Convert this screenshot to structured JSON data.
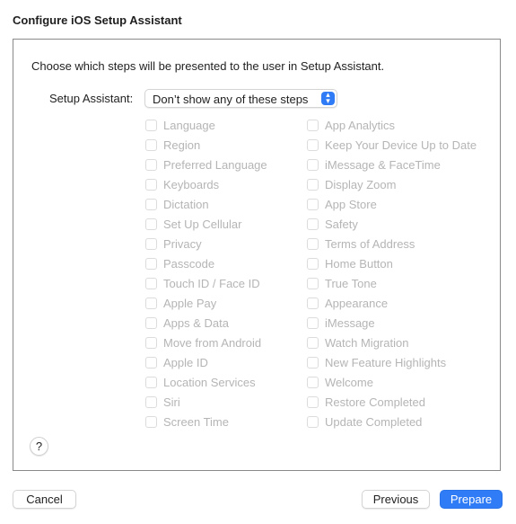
{
  "window": {
    "title": "Configure iOS Setup Assistant"
  },
  "panel": {
    "intro": "Choose which steps will be presented to the user in Setup Assistant.",
    "setup_assistant": {
      "label": "Setup Assistant:",
      "selected": "Don’t show any of these steps",
      "icon": "up-down-chevron-icon"
    },
    "steps_left": [
      {
        "label": "Language",
        "checked": false,
        "enabled": false
      },
      {
        "label": "Region",
        "checked": false,
        "enabled": false
      },
      {
        "label": "Preferred Language",
        "checked": false,
        "enabled": false
      },
      {
        "label": "Keyboards",
        "checked": false,
        "enabled": false
      },
      {
        "label": "Dictation",
        "checked": false,
        "enabled": false
      },
      {
        "label": "Set Up Cellular",
        "checked": false,
        "enabled": false
      },
      {
        "label": "Privacy",
        "checked": false,
        "enabled": false
      },
      {
        "label": "Passcode",
        "checked": false,
        "enabled": false
      },
      {
        "label": "Touch ID / Face ID",
        "checked": false,
        "enabled": false
      },
      {
        "label": "Apple Pay",
        "checked": false,
        "enabled": false
      },
      {
        "label": "Apps & Data",
        "checked": false,
        "enabled": false
      },
      {
        "label": "Move from Android",
        "checked": false,
        "enabled": false
      },
      {
        "label": "Apple ID",
        "checked": false,
        "enabled": false
      },
      {
        "label": "Location Services",
        "checked": false,
        "enabled": false
      },
      {
        "label": "Siri",
        "checked": false,
        "enabled": false
      },
      {
        "label": "Screen Time",
        "checked": false,
        "enabled": false
      }
    ],
    "steps_right": [
      {
        "label": "App Analytics",
        "checked": false,
        "enabled": false
      },
      {
        "label": "Keep Your Device Up to Date",
        "checked": false,
        "enabled": false
      },
      {
        "label": "iMessage & FaceTime",
        "checked": false,
        "enabled": false
      },
      {
        "label": "Display Zoom",
        "checked": false,
        "enabled": false
      },
      {
        "label": "App Store",
        "checked": false,
        "enabled": false
      },
      {
        "label": "Safety",
        "checked": false,
        "enabled": false
      },
      {
        "label": "Terms of Address",
        "checked": false,
        "enabled": false
      },
      {
        "label": "Home Button",
        "checked": false,
        "enabled": false
      },
      {
        "label": "True Tone",
        "checked": false,
        "enabled": false
      },
      {
        "label": "Appearance",
        "checked": false,
        "enabled": false
      },
      {
        "label": "iMessage",
        "checked": false,
        "enabled": false
      },
      {
        "label": "Watch Migration",
        "checked": false,
        "enabled": false
      },
      {
        "label": "New Feature Highlights",
        "checked": false,
        "enabled": false
      },
      {
        "label": "Welcome",
        "checked": false,
        "enabled": false
      },
      {
        "label": "Restore Completed",
        "checked": false,
        "enabled": false
      },
      {
        "label": "Update Completed",
        "checked": false,
        "enabled": false
      }
    ],
    "help": {
      "label": "?"
    }
  },
  "footer": {
    "cancel": "Cancel",
    "previous": "Previous",
    "prepare": "Prepare"
  },
  "colors": {
    "accent": "#2f7cf6",
    "disabled_text": "#b5b5b5"
  }
}
